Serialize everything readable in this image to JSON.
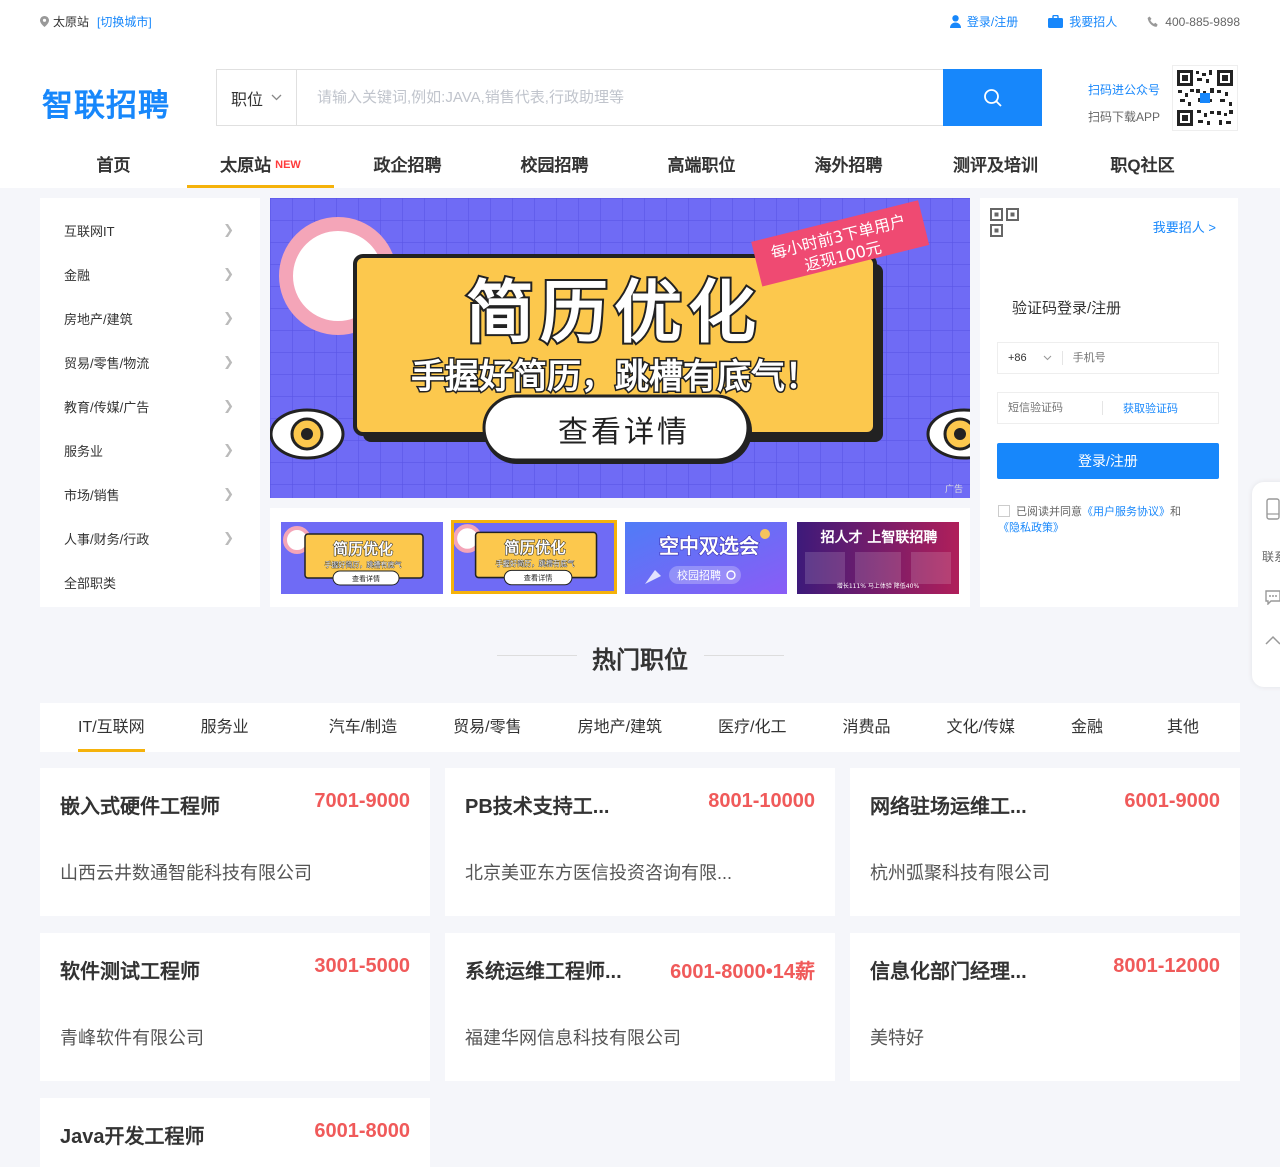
{
  "topbar": {
    "city": "太原站",
    "switch_city": "[切换城市]",
    "login_register": "登录/注册",
    "hire": "我要招人",
    "phone": "400-885-9898"
  },
  "header": {
    "logo": "智联招聘",
    "search_select": "职位",
    "search_placeholder": "请输入关键词,例如:JAVA,销售代表,行政助理等",
    "qr_official": "扫码进公众号",
    "qr_app": "扫码下载APP"
  },
  "nav": [
    {
      "label": "首页",
      "badge": ""
    },
    {
      "label": "太原站",
      "badge": "NEW"
    },
    {
      "label": "政企招聘",
      "badge": ""
    },
    {
      "label": "校园招聘",
      "badge": ""
    },
    {
      "label": "高端职位",
      "badge": ""
    },
    {
      "label": "海外招聘",
      "badge": ""
    },
    {
      "label": "测评及培训",
      "badge": ""
    },
    {
      "label": "职Q社区",
      "badge": ""
    }
  ],
  "categories": [
    "互联网IT",
    "金融",
    "房地产/建筑",
    "贸易/零售/物流",
    "教育/传媒/广告",
    "服务业",
    "市场/销售",
    "人事/财务/行政",
    "全部职类"
  ],
  "banner": {
    "ribbon_line1": "每小时前3下单用户",
    "ribbon_line2": "返现100元",
    "headline": "简历优化",
    "subline": "手握好简历，跳槽有底气！",
    "cta": "查看详情",
    "ad_tag": "广告"
  },
  "thumbs": [
    {
      "title": "简历优化",
      "sub": "手握好简历，跳槽有底气",
      "cta": "查看详情"
    },
    {
      "title": "简历优化",
      "sub": "手握好简历，跳槽有底气",
      "cta": "查看详情"
    },
    {
      "title": "空中双选会",
      "sub": "校园招聘"
    },
    {
      "title": "招人才 上智联招聘",
      "sub": "增长111% 马上体验 降低40%"
    }
  ],
  "login": {
    "hire_link": "我要招人 >",
    "title": "验证码登录/注册",
    "country_code": "+86",
    "phone_placeholder": "手机号",
    "code_placeholder": "短信验证码",
    "get_code": "获取验证码",
    "submit": "登录/注册",
    "agree_prefix": "已阅读并同意",
    "agreement": "《用户服务协议》",
    "and": "和",
    "privacy": "《隐私政策》"
  },
  "sidebar": {
    "label": "联系"
  },
  "section_title": "热门职位",
  "tabs": [
    "IT/互联网",
    "服务业",
    "汽车/制造",
    "贸易/零售",
    "房地产/建筑",
    "医疗/化工",
    "消费品",
    "文化/传媒",
    "金融",
    "其他"
  ],
  "jobs": [
    {
      "title": "嵌入式硬件工程师",
      "salary": "7001-9000",
      "company": "山西云井数通智能科技有限公司"
    },
    {
      "title": "PB技术支持工...",
      "salary": "8001-10000",
      "company": "北京美亚东方医信投资咨询有限..."
    },
    {
      "title": "网络驻场运维工...",
      "salary": "6001-9000",
      "company": "杭州弧聚科技有限公司"
    },
    {
      "title": "软件测试工程师",
      "salary": "3001-5000",
      "company": "青峰软件有限公司"
    },
    {
      "title": "系统运维工程师...",
      "salary": "6001-8000•14薪",
      "company": "福建华网信息科技有限公司"
    },
    {
      "title": "信息化部门经理...",
      "salary": "8001-12000",
      "company": "美特好"
    },
    {
      "title": "Java开发工程师",
      "salary": "6001-8000",
      "company": ""
    }
  ],
  "colors": {
    "primary": "#1787fb",
    "accent": "#f5b20b",
    "salary": "#f05a5a",
    "banner_bg": "#6f6bf5"
  }
}
